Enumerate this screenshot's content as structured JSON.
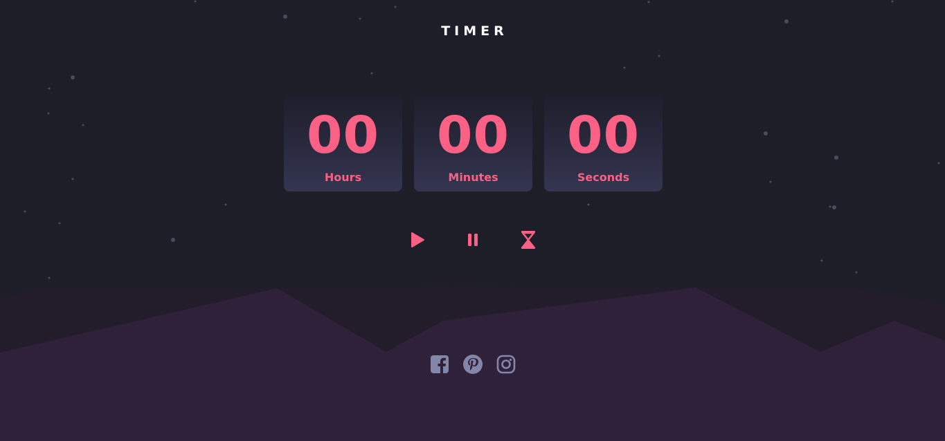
{
  "header": {
    "title": "TIMER"
  },
  "timer": {
    "units": [
      {
        "value": "00",
        "label": "Hours"
      },
      {
        "value": "00",
        "label": "Minutes"
      },
      {
        "value": "00",
        "label": "Seconds"
      }
    ]
  },
  "controls": [
    {
      "icon": "play-icon"
    },
    {
      "icon": "pause-icon"
    },
    {
      "icon": "hourglass-icon"
    }
  ],
  "social": [
    {
      "icon": "facebook-icon"
    },
    {
      "icon": "pinterest-icon"
    },
    {
      "icon": "instagram-icon"
    }
  ],
  "colors": {
    "background": "#1e1e29",
    "accent": "#fb6085",
    "hills_front": "#30213b",
    "hills_back": "#261c2c",
    "social_icon": "#8385a9",
    "title": "#ffffff"
  }
}
